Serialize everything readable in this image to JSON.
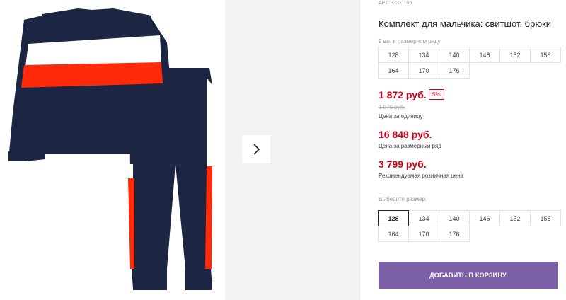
{
  "product": {
    "article": "АРТ: 32311105",
    "title": "Комплект для мальчика: свитшот, брюки",
    "row_note": "9 шт. в размерном ряду",
    "row_sizes": [
      "128",
      "134",
      "140",
      "146",
      "152",
      "158",
      "164",
      "170",
      "176"
    ]
  },
  "prices": {
    "unit_price": "1 872 руб.",
    "discount_badge": "5%",
    "old_price": "1 970 руб.",
    "unit_caption": "Цена за единицу",
    "row_price": "16 848 руб.",
    "row_caption": "Цена за размерный ряд",
    "retail_price": "3 799 руб.",
    "retail_caption": "Рекомендуемая розничная цена"
  },
  "select": {
    "label": "Выберите размер:",
    "sizes": [
      "128",
      "134",
      "140",
      "146",
      "152",
      "158",
      "164",
      "170",
      "176"
    ],
    "selected": "128"
  },
  "actions": {
    "add_to_cart": "ДОБАВИТЬ В КОРЗИНУ"
  },
  "colors": {
    "accent": "#7b60a8",
    "price": "#d0021b",
    "navy": "#1c2542",
    "stripe_red": "#ff2a0a"
  },
  "icons": {
    "next": "chevron-right-icon"
  }
}
